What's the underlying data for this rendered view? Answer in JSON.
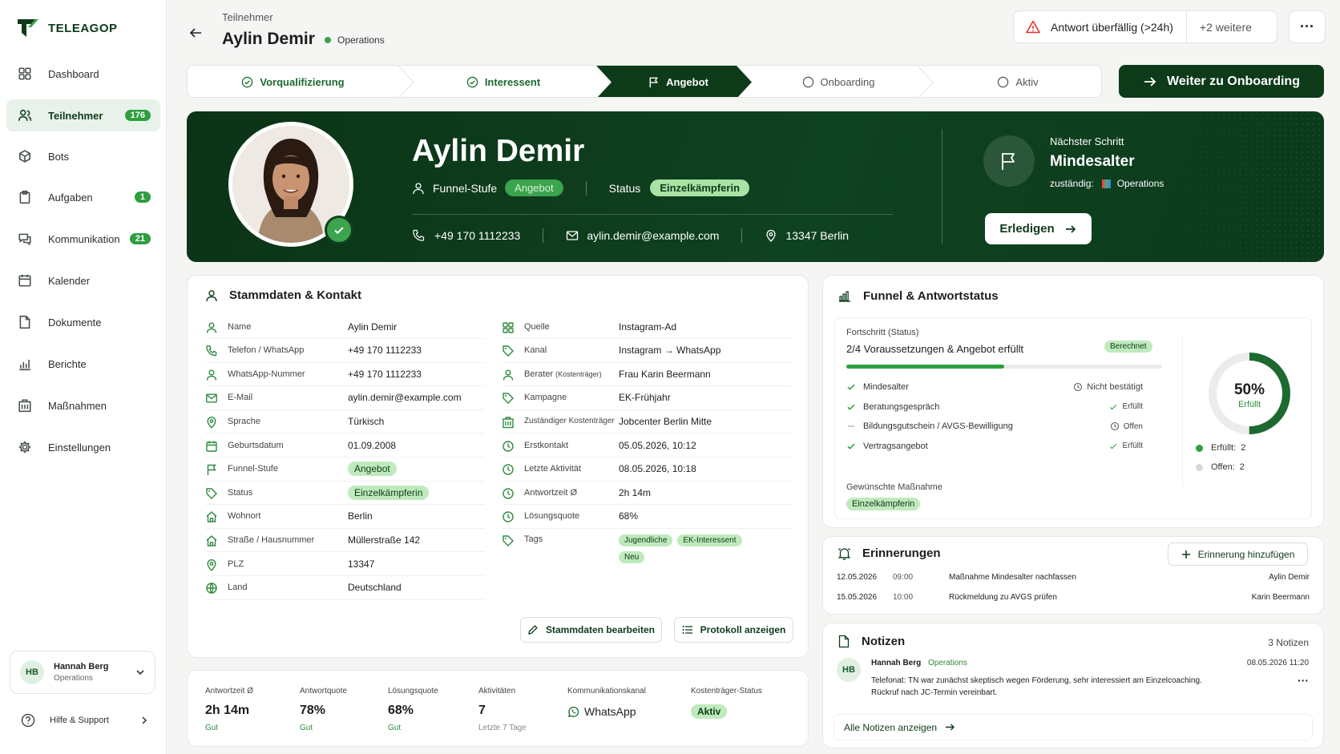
{
  "app": {
    "name": "TELEAGOP"
  },
  "sidebar": {
    "items": [
      {
        "label": "Dashboard",
        "icon": "grid-icon"
      },
      {
        "label": "Teilnehmer",
        "icon": "users-icon",
        "badge": "176",
        "active": true
      },
      {
        "label": "Bots",
        "icon": "bot-icon"
      },
      {
        "label": "Aufgaben",
        "icon": "clipboard-icon",
        "badge": "1"
      },
      {
        "label": "Kommunikation",
        "icon": "chat-icon",
        "badge": "21"
      },
      {
        "label": "Kalender",
        "icon": "calendar-icon"
      },
      {
        "label": "Dokumente",
        "icon": "document-icon"
      },
      {
        "label": "Berichte",
        "icon": "bar-chart-icon"
      },
      {
        "label": "Maßnahmen",
        "icon": "building-icon"
      },
      {
        "label": "Einstellungen",
        "icon": "gear-icon"
      }
    ],
    "user": {
      "initials": "HB",
      "name": "Hannah Berg",
      "role": "Operations"
    },
    "help": "Hilfe & Support"
  },
  "header": {
    "breadcrumb": "Teilnehmer",
    "title": "Aylin Demir",
    "team": "Operations",
    "alert": "Antwort überfällig (>24h)",
    "alert_more": "+2 weitere"
  },
  "stepper": {
    "steps": [
      {
        "label": "Vorqualifizierung",
        "state": "done"
      },
      {
        "label": "Interessent",
        "state": "done"
      },
      {
        "label": "Angebot",
        "state": "current"
      },
      {
        "label": "Onboarding",
        "state": "todo"
      },
      {
        "label": "Aktiv",
        "state": "todo"
      }
    ],
    "next_button": "Weiter zu Onboarding"
  },
  "hero": {
    "name": "Aylin Demir",
    "funnel_label": "Funnel-Stufe",
    "funnel_value": "Angebot",
    "status_label": "Status",
    "status_value": "Einzelkämpferin",
    "phone": "+49 170 1112233",
    "email": "aylin.demir@example.com",
    "location": "13347 Berlin",
    "next_step_label": "Nächster Schritt",
    "next_step_value": "Mindesalter",
    "responsible_label": "zuständig:",
    "responsible_value": "Operations",
    "done_button": "Erledigen"
  },
  "stammdaten": {
    "title": "Stammdaten & Kontakt",
    "left": [
      {
        "icon": "user-icon",
        "label": "Name",
        "value": "Aylin Demir"
      },
      {
        "icon": "phone-icon",
        "label": "Telefon / WhatsApp",
        "value": "+49 170 1112233"
      },
      {
        "icon": "user-icon",
        "label": "WhatsApp-Nummer",
        "value": "+49 170 1112233"
      },
      {
        "icon": "mail-icon",
        "label": "E-Mail",
        "value": "aylin.demir@example.com"
      },
      {
        "icon": "pin-icon",
        "label": "Sprache",
        "value": "Türkisch"
      },
      {
        "icon": "calendar-icon",
        "label": "Geburtsdatum",
        "value": "01.09.2008"
      },
      {
        "icon": "flag-icon",
        "label": "Funnel-Stufe",
        "pill": "Angebot"
      },
      {
        "icon": "tag-icon",
        "label": "Status",
        "pill": "Einzelkämpferin"
      },
      {
        "icon": "home-icon",
        "label": "Wohnort",
        "value": "Berlin"
      },
      {
        "icon": "home-icon",
        "label": "Straße / Hausnummer",
        "value": "Müllerstraße 142"
      },
      {
        "icon": "pin-icon",
        "label": "PLZ",
        "value": "13347"
      },
      {
        "icon": "globe-icon",
        "label": "Land",
        "value": "Deutschland"
      }
    ],
    "right": [
      {
        "icon": "grid-icon",
        "label": "Quelle",
        "value": "Instagram-Ad"
      },
      {
        "icon": "tag-icon",
        "label": "Kanal",
        "value": "Instagram → WhatsApp"
      },
      {
        "icon": "user-icon",
        "label": "Berater",
        "label_small": "(Kostenträger)",
        "value": "Frau Karin Beermann"
      },
      {
        "icon": "tag-icon",
        "label": "Kampagne",
        "value": "EK-Frühjahr"
      },
      {
        "icon": "building-icon",
        "label": "Zuständiger Kostenträger",
        "value": "Jobcenter Berlin Mitte",
        "small": true
      },
      {
        "icon": "clock-icon",
        "label": "Erstkontakt",
        "value": "05.05.2026, 10:12"
      },
      {
        "icon": "clock-icon",
        "label": "Letzte Aktivität",
        "value": "08.05.2026, 10:18"
      },
      {
        "icon": "clock-icon",
        "label": "Antwortzeit Ø",
        "value": "2h 14m"
      },
      {
        "icon": "clock-icon",
        "label": "Lösungsquote",
        "value": "68%"
      },
      {
        "icon": "tag-icon",
        "label": "Tags",
        "tags": [
          "Jugendliche",
          "EK-Interessent",
          "Neu"
        ]
      }
    ],
    "edit_button": "Stammdaten bearbeiten",
    "log_button": "Protokoll anzeigen"
  },
  "kpis": [
    {
      "label": "Antwortzeit Ø",
      "value": "2h 14m",
      "sub": "Gut"
    },
    {
      "label": "Antwortquote",
      "value": "78%",
      "sub": "Gut"
    },
    {
      "label": "Lösungsquote",
      "value": "68%",
      "sub": "Gut"
    },
    {
      "label": "Aktivitäten",
      "value": "7",
      "sub": "Letzte 7 Tage"
    },
    {
      "label": "Kommunikationskanal",
      "value": "WhatsApp"
    },
    {
      "label": "Kostenträger-Status",
      "pill": "Aktiv"
    }
  ],
  "funnel": {
    "title": "Funnel & Antwortstatus",
    "progress_label": "Fortschritt (Status)",
    "progress_text": "2/4 Voraussetzungen & Angebot erfüllt",
    "computed_badge": "Berechnet",
    "progress_fraction": 0.5,
    "checks": [
      {
        "label": "Mindesalter",
        "status": "Nicht bestätigt",
        "status_icon": "clock-icon"
      },
      {
        "label": "Beratungsgespräch",
        "status": "Erfüllt",
        "status_icon": "check-icon"
      },
      {
        "label": "Bildungsgutschein / AVGS-Bewilligung",
        "status": "Offen",
        "status_icon": "clock-icon",
        "pending": true
      },
      {
        "label": "Vertragsangebot",
        "status": "Erfüllt",
        "status_icon": "check-icon"
      }
    ],
    "wish_label": "Gewünschte Maßnahme",
    "wish_value": "Einzelkämpferin",
    "donut_value": "50%",
    "donut_label": "Erfüllt",
    "legend": [
      {
        "label": "Erfüllt:",
        "value": "2",
        "color": "#2e9e3f"
      },
      {
        "label": "Offen:",
        "value": "2",
        "color": "#d6d8d5"
      }
    ]
  },
  "reminders": {
    "title": "Erinnerungen",
    "add_button": "Erinnerung hinzufügen",
    "items": [
      {
        "date": "12.05.2026",
        "time": "09:00",
        "text": "Maßnahme Mindesalter nachfassen",
        "person": "Aylin Demir"
      },
      {
        "date": "15.05.2026",
        "time": "10:00",
        "text": "Rückmeldung zu AVGS prüfen",
        "person": "Karin Beermann"
      }
    ]
  },
  "notes": {
    "title": "Notizen",
    "count": "3 Notizen",
    "item": {
      "initials": "HB",
      "author": "Hannah Berg",
      "team": "Operations",
      "date": "08.05.2026 11:20",
      "line1": "Telefonat: TN war zunächst skeptisch wegen Förderung, sehr interessiert am Einzelcoaching.",
      "line2": "Rückruf nach JC-Termin vereinbart."
    },
    "all_link": "Alle Notizen anzeigen"
  },
  "colors": {
    "brand": "#0d3b1a",
    "accent": "#2e9e3f",
    "pill": "#bfeabc"
  }
}
